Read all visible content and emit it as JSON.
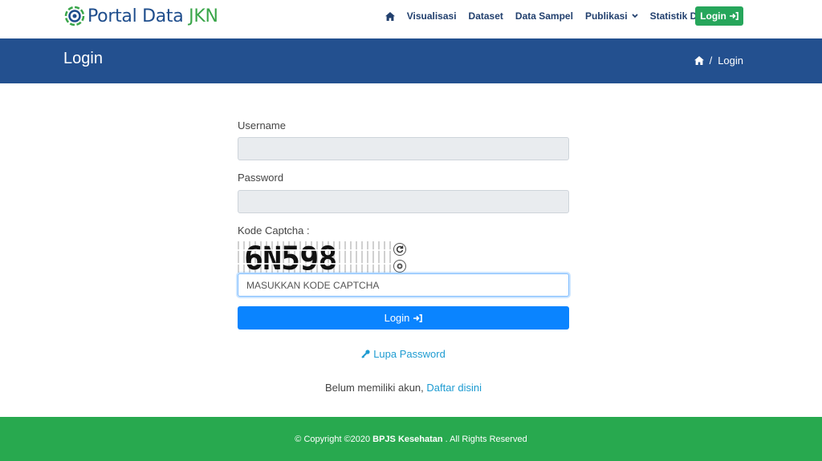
{
  "brand": {
    "name_main": "Portal Data ",
    "name_accent": "JKN",
    "logo_icon": "portal-logo-icon"
  },
  "nav": {
    "home_icon": "home-icon",
    "items": [
      {
        "label": "Visualisasi",
        "dropdown": false
      },
      {
        "label": "Dataset",
        "dropdown": false
      },
      {
        "label": "Data Sampel",
        "dropdown": false
      },
      {
        "label": "Publikasi",
        "dropdown": true
      },
      {
        "label": "Statistik Data JKN",
        "dropdown": true
      }
    ],
    "login_label": "Login",
    "login_icon": "sign-in-icon"
  },
  "header": {
    "title": "Login",
    "breadcrumb": {
      "home_icon": "home-icon",
      "separator": "/",
      "current": "Login"
    }
  },
  "form": {
    "username_label": "Username",
    "username_value": "",
    "password_label": "Password",
    "password_value": "",
    "captcha_label": "Kode Captcha :",
    "captcha_text": "6N598",
    "captcha_refresh_icon": "refresh-icon",
    "captcha_audio_icon": "audio-icon",
    "captcha_placeholder": "MASUKKAN KODE CAPTCHA",
    "submit_label": "Login",
    "forgot_label": "Lupa Password",
    "forgot_icon": "key-icon",
    "register_text": "Belum memiliki akun,",
    "register_link": "Daftar disini"
  },
  "footer": {
    "prefix": "© Copyright ©2020",
    "org": "BPJS Kesehatan",
    "suffix": ". All Rights Reserved"
  },
  "colors": {
    "navy": "#23508f",
    "green": "#28a94f",
    "primary": "#0a84ff",
    "link": "#1d9bd1"
  }
}
